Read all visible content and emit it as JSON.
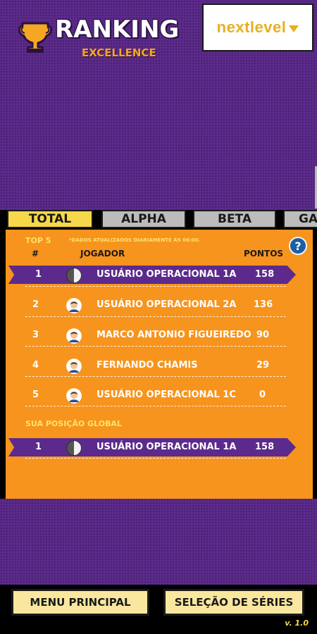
{
  "header": {
    "title": "RANKING",
    "subtitle": "EXCELLENCE",
    "logo_text": "nextlevel"
  },
  "tabs": [
    {
      "label": "TOTAL",
      "active": true
    },
    {
      "label": "ALPHA",
      "active": false
    },
    {
      "label": "BETA",
      "active": false
    },
    {
      "label": "GA",
      "active": false
    }
  ],
  "ranking": {
    "section_label": "TOP 5",
    "updated_note": "*DADOS ATUALIZADOS DIARIAMENTE ÀS 06:00.",
    "help_label": "?",
    "columns": {
      "rank": "#",
      "player": "JOGADOR",
      "points": "PONTOS"
    },
    "rows": [
      {
        "rank": "1",
        "player": "USUÁRIO OPERACIONAL 1A",
        "points": "158"
      },
      {
        "rank": "2",
        "player": "USUÁRIO OPERACIONAL 2A",
        "points": "136"
      },
      {
        "rank": "3",
        "player": "MARCO ANTONIO FIGUEIREDO",
        "points": "90"
      },
      {
        "rank": "4",
        "player": "FERNANDO CHAMIS",
        "points": "29"
      },
      {
        "rank": "5",
        "player": "USUÁRIO OPERACIONAL 1C",
        "points": "0"
      }
    ],
    "global_label": "SUA POSIÇÃO GLOBAL",
    "global_row": {
      "rank": "1",
      "player": "USUÁRIO OPERACIONAL 1A",
      "points": "158"
    }
  },
  "footer": {
    "menu_label": "MENU PRINCIPAL",
    "series_label": "SELEÇÃO DE SÉRIES",
    "version": "v. 1.0"
  },
  "colors": {
    "purple": "#5c2a8c",
    "orange": "#f7941d",
    "yellow": "#f7d84a",
    "tab_inactive": "#bcbcbc",
    "logo_gold": "#e6b020"
  }
}
